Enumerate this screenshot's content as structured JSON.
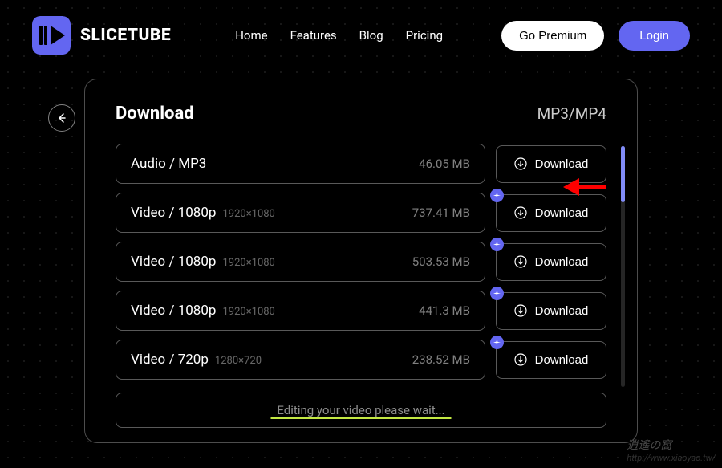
{
  "brand": {
    "name": "SLICETUBE"
  },
  "nav": {
    "home": "Home",
    "features": "Features",
    "blog": "Blog",
    "pricing": "Pricing"
  },
  "header_actions": {
    "premium": "Go Premium",
    "login": "Login"
  },
  "panel": {
    "title": "Download",
    "format": "MP3/MP4",
    "items": [
      {
        "type": "Audio / MP3",
        "resolution": "",
        "size": "46.05 MB",
        "badge": false,
        "button": "Download"
      },
      {
        "type": "Video / 1080p",
        "resolution": "1920×1080",
        "size": "737.41 MB",
        "badge": true,
        "button": "Download"
      },
      {
        "type": "Video / 1080p",
        "resolution": "1920×1080",
        "size": "503.53 MB",
        "badge": true,
        "button": "Download"
      },
      {
        "type": "Video / 1080p",
        "resolution": "1920×1080",
        "size": "441.3 MB",
        "badge": true,
        "button": "Download"
      },
      {
        "type": "Video / 720p",
        "resolution": "1280×720",
        "size": "238.52 MB",
        "badge": true,
        "button": "Download"
      }
    ],
    "status": "Editing your video please wait..."
  },
  "watermark": {
    "chars": "逍遙の窩",
    "url": "http://www.xiaoyao.tw/"
  }
}
